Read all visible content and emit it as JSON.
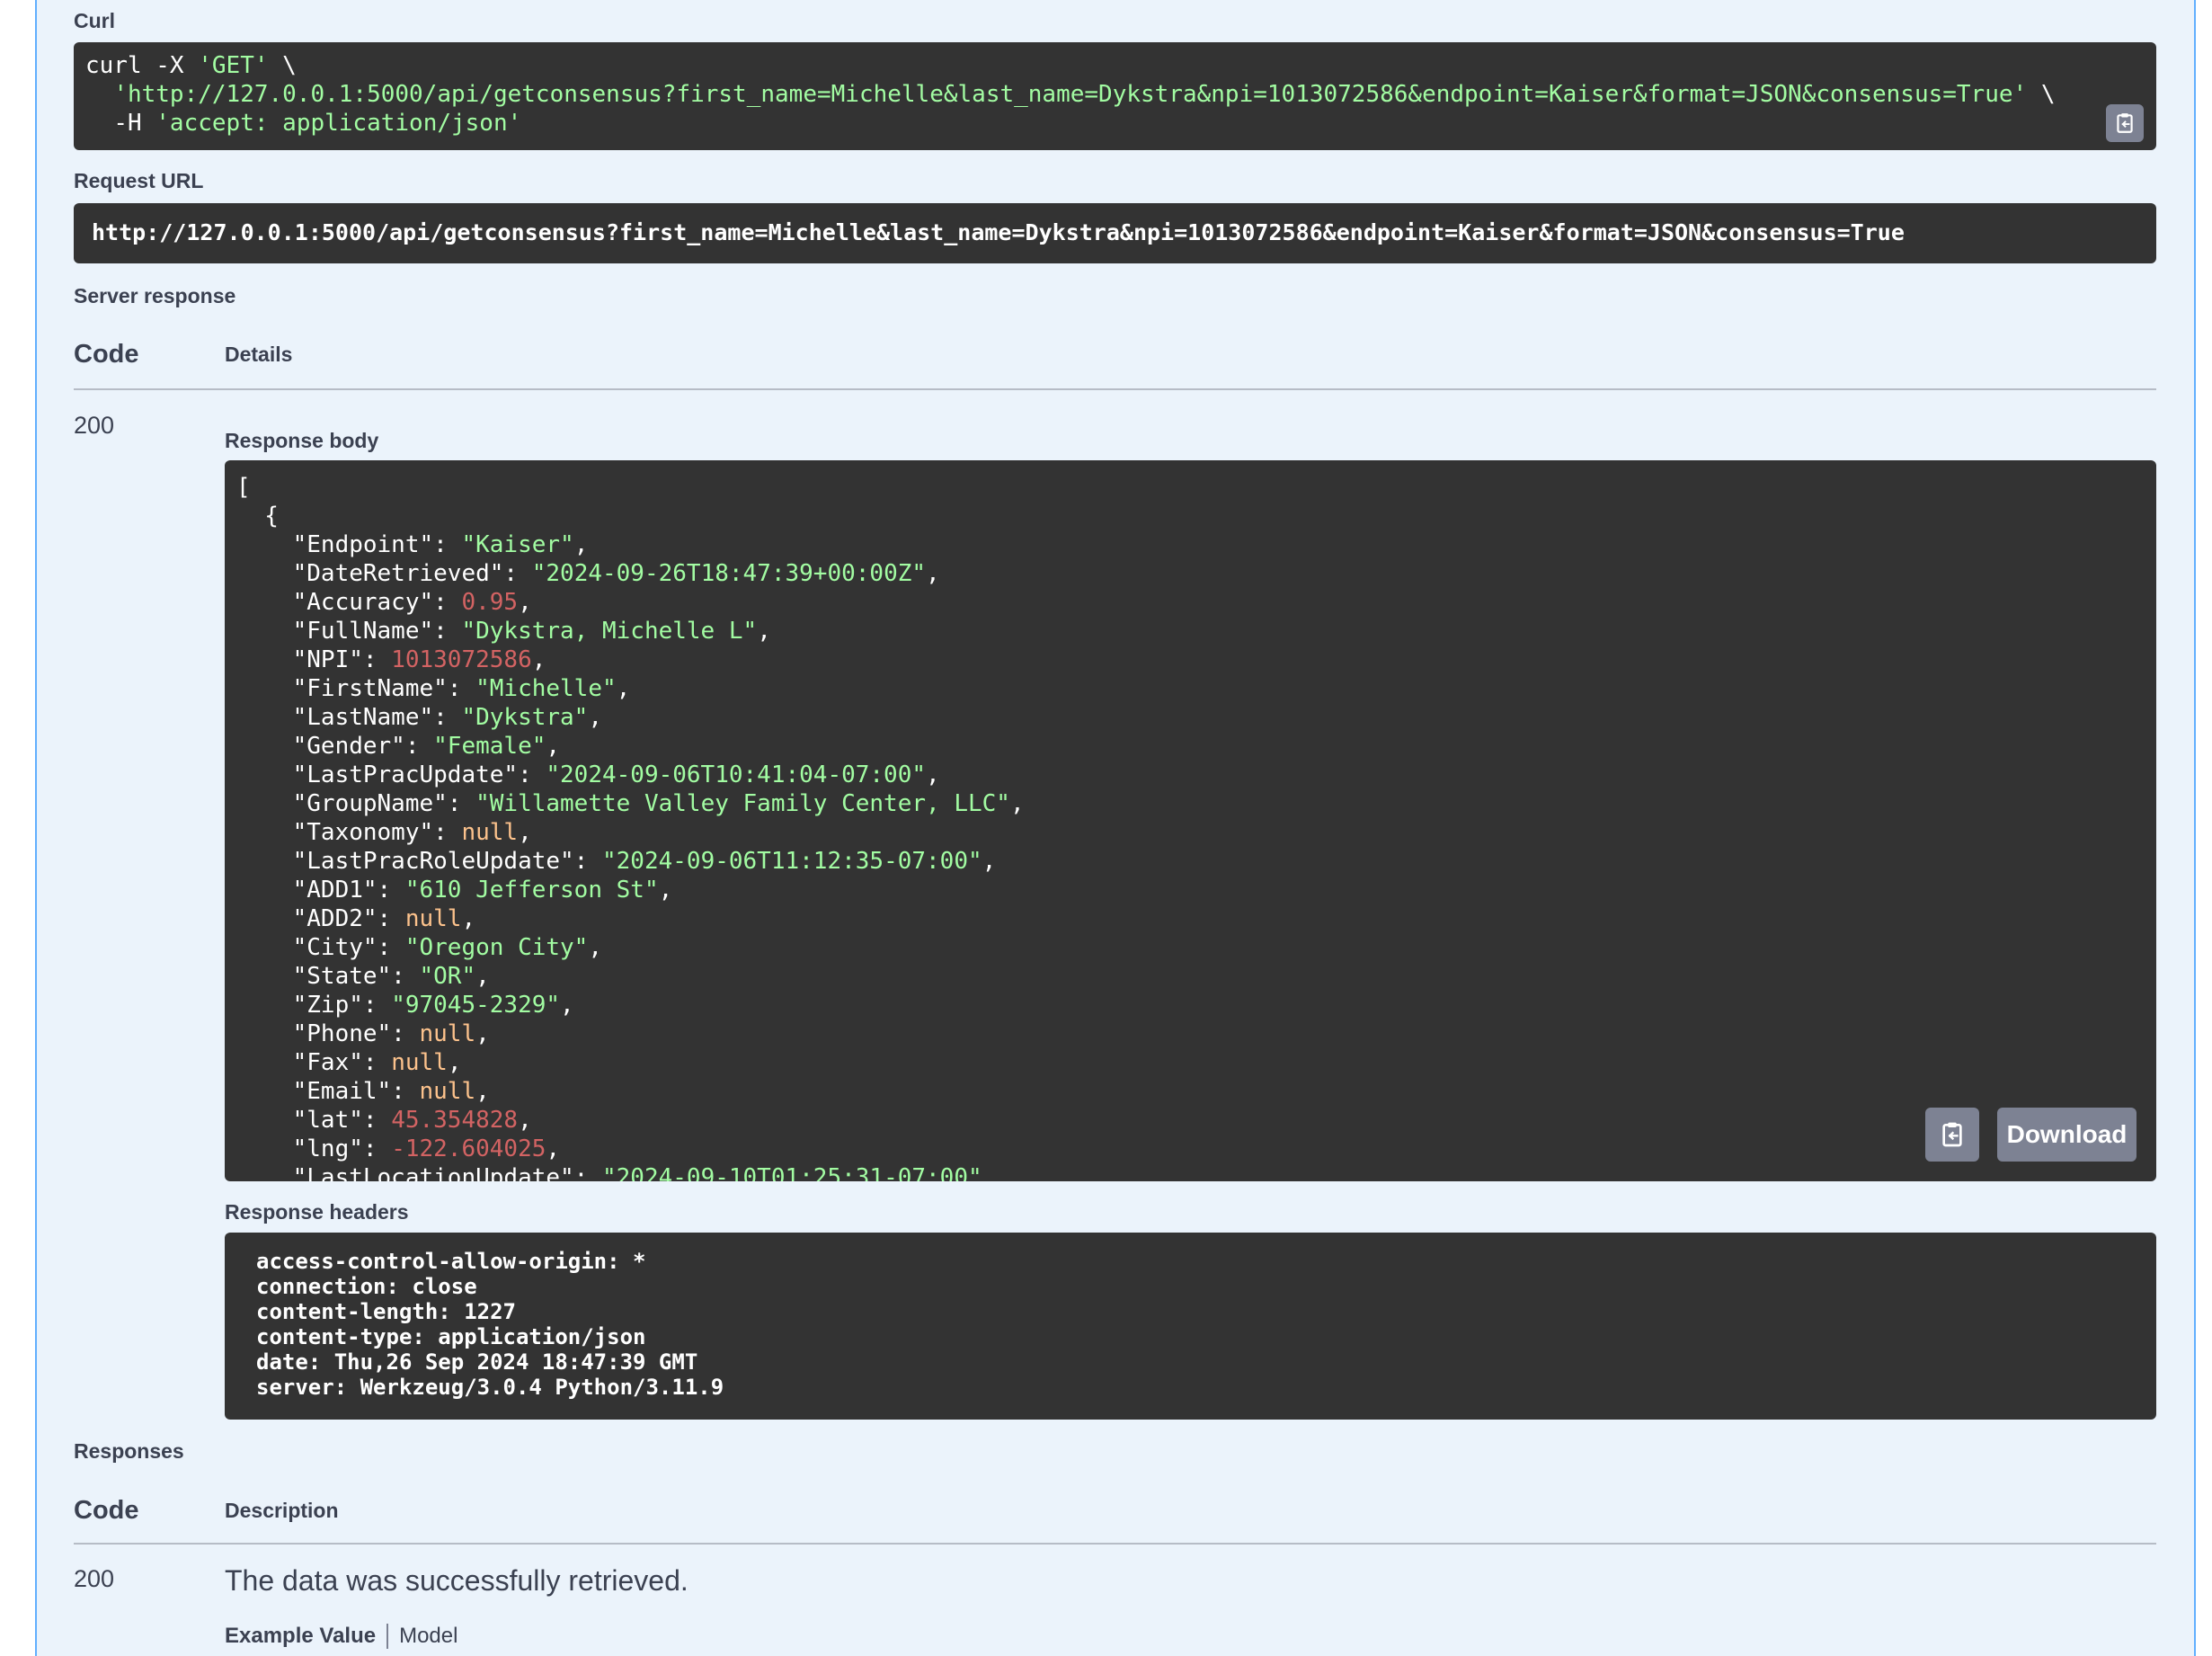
{
  "curl": {
    "label": "Curl",
    "line1_cmd": "curl -X ",
    "line1_method": "'GET'",
    "line1_tail": " \\",
    "line2_url": "'http://127.0.0.1:5000/api/getconsensus?first_name=Michelle&last_name=Dykstra&npi=1013072586&endpoint=Kaiser&format=JSON&consensus=True'",
    "line2_tail": " \\",
    "line3_flag": "-H ",
    "line3_header": "'accept: application/json'"
  },
  "request_url": {
    "label": "Request URL",
    "value": "http://127.0.0.1:5000/api/getconsensus?first_name=Michelle&last_name=Dykstra&npi=1013072586&endpoint=Kaiser&format=JSON&consensus=True"
  },
  "server_response": {
    "label": "Server response",
    "code_header": "Code",
    "details_header": "Details",
    "code": "200",
    "response_body_label": "Response body",
    "response_headers_label": "Response headers",
    "download_label": "Download",
    "body": [
      {
        "key": "Endpoint",
        "value": "\"Kaiser\"",
        "type": "s"
      },
      {
        "key": "DateRetrieved",
        "value": "\"2024-09-26T18:47:39+00:00Z\"",
        "type": "s"
      },
      {
        "key": "Accuracy",
        "value": "0.95",
        "type": "n"
      },
      {
        "key": "FullName",
        "value": "\"Dykstra, Michelle L\"",
        "type": "s"
      },
      {
        "key": "NPI",
        "value": "1013072586",
        "type": "n"
      },
      {
        "key": "FirstName",
        "value": "\"Michelle\"",
        "type": "s"
      },
      {
        "key": "LastName",
        "value": "\"Dykstra\"",
        "type": "s"
      },
      {
        "key": "Gender",
        "value": "\"Female\"",
        "type": "s"
      },
      {
        "key": "LastPracUpdate",
        "value": "\"2024-09-06T10:41:04-07:00\"",
        "type": "s"
      },
      {
        "key": "GroupName",
        "value": "\"Willamette Valley Family Center, LLC\"",
        "type": "s"
      },
      {
        "key": "Taxonomy",
        "value": "null",
        "type": "k"
      },
      {
        "key": "LastPracRoleUpdate",
        "value": "\"2024-09-06T11:12:35-07:00\"",
        "type": "s"
      },
      {
        "key": "ADD1",
        "value": "\"610 Jefferson St\"",
        "type": "s"
      },
      {
        "key": "ADD2",
        "value": "null",
        "type": "k"
      },
      {
        "key": "City",
        "value": "\"Oregon City\"",
        "type": "s"
      },
      {
        "key": "State",
        "value": "\"OR\"",
        "type": "s"
      },
      {
        "key": "Zip",
        "value": "\"97045-2329\"",
        "type": "s"
      },
      {
        "key": "Phone",
        "value": "null",
        "type": "k"
      },
      {
        "key": "Fax",
        "value": "null",
        "type": "k"
      },
      {
        "key": "Email",
        "value": "null",
        "type": "k"
      },
      {
        "key": "lat",
        "value": "45.354828",
        "type": "n"
      },
      {
        "key": "lng",
        "value": "-122.604025",
        "type": "n"
      },
      {
        "key": "LastLocationUpdate",
        "value": "\"2024-09-10T01:25:31-07:00\"",
        "type": "s"
      }
    ],
    "headers": [
      "access-control-allow-origin: *",
      "connection: close",
      "content-length: 1227",
      "content-type: application/json",
      "date: Thu,26 Sep 2024 18:47:39 GMT",
      "server: Werkzeug/3.0.4 Python/3.11.9"
    ]
  },
  "responses": {
    "label": "Responses",
    "code_header": "Code",
    "description_header": "Description",
    "code": "200",
    "description": "The data was successfully retrieved.",
    "example_value_tab": "Example Value",
    "model_tab": "Model"
  },
  "icons": {
    "copy": "clipboard-icon"
  }
}
